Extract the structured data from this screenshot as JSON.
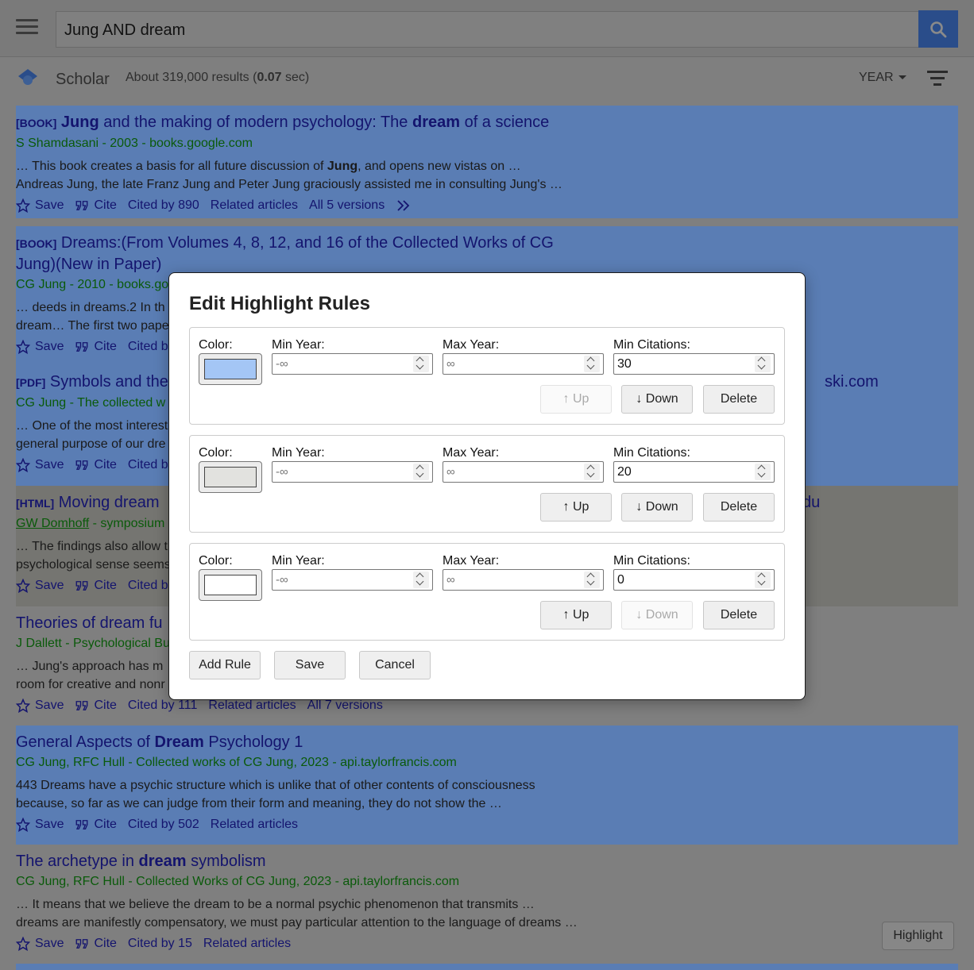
{
  "search": {
    "query": "Jung AND dream"
  },
  "header": {
    "scholar_label": "Scholar",
    "results_prefix": "About 319,000 results (",
    "results_time": "0.07",
    "results_suffix": " sec)",
    "year_label": "YEAR"
  },
  "results": [
    {
      "kind": "[BOOK]",
      "title_parts": [
        "Jung",
        " and the making of modern psychology: The ",
        "dream",
        " of a science"
      ],
      "meta": "S Shamdasani - 2003 - books.google.com",
      "snippet_1": "… This book creates a basis for all future discussion of ",
      "snippet_1b": "Jung",
      "snippet_1c": ", and opens new vistas on …",
      "snippet_2": "Andreas Jung, the late Franz Jung and Peter Jung graciously assisted me in consulting Jung's …",
      "cited": "Cited by 890",
      "related": "Related articles",
      "versions": "All 5 versions"
    },
    {
      "kind": "[BOOK]",
      "title_line1": "Dreams:(From Volumes 4, 8, 12, and 16 of the Collected Works of CG",
      "title_line2": "Jung)(New in Paper)",
      "meta": "CG Jung - 2010 - books.go",
      "snippet_1": "… deeds in dreams.2 In th",
      "snippet_2": "dream… The first two pape",
      "cited": "Cited b"
    },
    {
      "kind": "[PDF]",
      "title": "Symbols and the",
      "title_tail": "ski.com",
      "meta": "CG Jung - The collected w",
      "snippet_1": "… One of the most interest",
      "snippet_2": "general purpose of our dre",
      "cited": "Cited b"
    },
    {
      "kind": "[HTML]",
      "title": "Moving dream",
      "title_tail": "du",
      "meta_author": "GW Domhoff",
      "meta_rest": " - symposium",
      "snippet_1": "… The findings also allow t",
      "snippet_2": "psychological sense seems",
      "cited": "Cited b"
    },
    {
      "title": "Theories of dream fu",
      "meta": "J Dallett - Psychological Bu",
      "snippet_1": "… Jung's approach has m",
      "snippet_2": "room for creative and nonr",
      "cited": "Cited by 111",
      "related": "Related articles",
      "versions": "All 7 versions"
    },
    {
      "title_parts": [
        "General Aspects of ",
        "Dream",
        " Psychology 1"
      ],
      "meta": "CG Jung, RFC Hull - Collected works of CG Jung, 2023 - api.taylorfrancis.com",
      "snippet_1": "443 Dreams have a psychic structure which is unlike that of other contents of consciousness",
      "snippet_2": "because, so far as we can judge from their form and meaning, they do not show the …",
      "cited": "Cited by 502",
      "related": "Related articles"
    },
    {
      "title_parts": [
        "The archetype in ",
        "dream",
        " symbolism"
      ],
      "meta": "CG Jung, RFC Hull - Collected Works of CG Jung, 2023 - api.taylorfrancis.com",
      "snippet_1": "… It means that we believe the dream to be a normal psychic phenomenon that transmits …",
      "snippet_2": "dreams are manifestly compensatory, we must pay particular attention to the language of dreams …",
      "cited": "Cited by 15",
      "related": "Related articles"
    }
  ],
  "actions": {
    "save": "Save",
    "cite": "Cite"
  },
  "modal": {
    "title": "Edit Highlight Rules",
    "labels": {
      "color": "Color:",
      "min_year": "Min Year:",
      "max_year": "Max Year:",
      "min_citations": "Min Citations:"
    },
    "placeholders": {
      "min_year": "-∞",
      "max_year": "∞"
    },
    "rules": [
      {
        "color": "#a4c6f5",
        "min_citations": "30",
        "up_enabled": false,
        "down_enabled": true
      },
      {
        "color": "#e2e2df",
        "min_citations": "20",
        "up_enabled": true,
        "down_enabled": true
      },
      {
        "color": "#ffffff",
        "min_citations": "0",
        "up_enabled": true,
        "down_enabled": false
      }
    ],
    "buttons": {
      "up": "↑ Up",
      "down": "↓ Down",
      "delete": "Delete",
      "add_rule": "Add Rule",
      "save": "Save",
      "cancel": "Cancel"
    }
  },
  "highlight_button": "Highlight",
  "colors": {
    "accent": "#2a4d8a",
    "highlight_blue": "#5a7db4",
    "highlight_grey": "#757571"
  }
}
